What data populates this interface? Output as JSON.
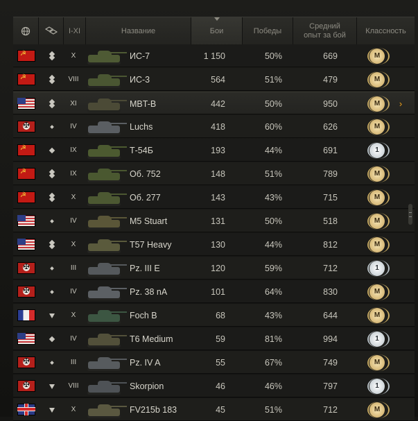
{
  "header": {
    "col_nation_icon": "globe-icon",
    "col_type_icon": "vehicle-type-icon",
    "col_tier": "I-XI",
    "col_name": "Название",
    "col_battles": "Бои",
    "col_wins": "Победы",
    "col_avg_xp_line1": "Средний",
    "col_avg_xp_line2": "опыт за бой",
    "col_class": "Классность"
  },
  "sort": {
    "column": "battles",
    "direction": "desc"
  },
  "rows": [
    {
      "nation": "ussr",
      "type": "heavy",
      "tier": "X",
      "name": "ИС-7",
      "battles": "1 150",
      "wins": "50%",
      "xp": "669",
      "mastery": "M",
      "medal": "gold",
      "tank_color": "#4e5a34"
    },
    {
      "nation": "ussr",
      "type": "heavy",
      "tier": "VIII",
      "name": "ИС-3",
      "battles": "564",
      "wins": "51%",
      "xp": "479",
      "mastery": "M",
      "medal": "gold",
      "tank_color": "#4a5632"
    },
    {
      "nation": "usa",
      "type": "heavy",
      "tier": "XI",
      "name": "MBT-B",
      "battles": "442",
      "wins": "50%",
      "xp": "950",
      "mastery": "M",
      "medal": "gold",
      "tank_color": "#4b4a36",
      "selected": true
    },
    {
      "nation": "ger",
      "type": "light",
      "tier": "IV",
      "name": "Luchs",
      "battles": "418",
      "wins": "60%",
      "xp": "626",
      "mastery": "M",
      "medal": "gold",
      "tank_color": "#5a5e62"
    },
    {
      "nation": "ussr",
      "type": "medium",
      "tier": "IX",
      "name": "Т-54Б",
      "battles": "193",
      "wins": "44%",
      "xp": "691",
      "mastery": "1",
      "medal": "silver",
      "tank_color": "#4c5a30"
    },
    {
      "nation": "ussr",
      "type": "heavy",
      "tier": "IX",
      "name": "Об. 752",
      "battles": "148",
      "wins": "51%",
      "xp": "789",
      "mastery": "M",
      "medal": "gold",
      "tank_color": "#4a5830"
    },
    {
      "nation": "ussr",
      "type": "heavy",
      "tier": "X",
      "name": "Об. 277",
      "battles": "143",
      "wins": "43%",
      "xp": "715",
      "mastery": "M",
      "medal": "gold",
      "tank_color": "#4c5832"
    },
    {
      "nation": "usa",
      "type": "light",
      "tier": "IV",
      "name": "M5 Stuart",
      "battles": "131",
      "wins": "50%",
      "xp": "518",
      "mastery": "M",
      "medal": "gold",
      "tank_color": "#5a5638"
    },
    {
      "nation": "usa",
      "type": "heavy",
      "tier": "X",
      "name": "T57 Heavy",
      "battles": "130",
      "wins": "44%",
      "xp": "812",
      "mastery": "M",
      "medal": "gold",
      "tank_color": "#5a5a3c"
    },
    {
      "nation": "ger",
      "type": "light",
      "tier": "III",
      "name": "Pz. III E",
      "battles": "120",
      "wins": "59%",
      "xp": "712",
      "mastery": "1",
      "medal": "silver",
      "tank_color": "#55595c"
    },
    {
      "nation": "ger",
      "type": "light",
      "tier": "IV",
      "name": "Pz. 38 nA",
      "battles": "101",
      "wins": "64%",
      "xp": "830",
      "mastery": "M",
      "medal": "gold",
      "tank_color": "#5c6064"
    },
    {
      "nation": "fra",
      "type": "td",
      "tier": "X",
      "name": "Foch B",
      "battles": "68",
      "wins": "43%",
      "xp": "644",
      "mastery": "M",
      "medal": "gold",
      "tank_color": "#3c5642"
    },
    {
      "nation": "usa",
      "type": "medium",
      "tier": "IV",
      "name": "T6 Medium",
      "battles": "59",
      "wins": "81%",
      "xp": "994",
      "mastery": "1",
      "medal": "silver",
      "tank_color": "#52503a"
    },
    {
      "nation": "ger",
      "type": "light",
      "tier": "III",
      "name": "Pz. IV A",
      "battles": "55",
      "wins": "67%",
      "xp": "749",
      "mastery": "M",
      "medal": "gold",
      "tank_color": "#575b5e"
    },
    {
      "nation": "ger",
      "type": "td",
      "tier": "VIII",
      "name": "Skorpion",
      "battles": "46",
      "wins": "46%",
      "xp": "797",
      "mastery": "1",
      "medal": "silver",
      "tank_color": "#4e5256"
    },
    {
      "nation": "uk",
      "type": "td",
      "tier": "X",
      "name": "FV215b 183",
      "battles": "45",
      "wins": "51%",
      "xp": "712",
      "mastery": "M",
      "medal": "gold",
      "tank_color": "#5a5840"
    }
  ],
  "selected_arrow": "›"
}
